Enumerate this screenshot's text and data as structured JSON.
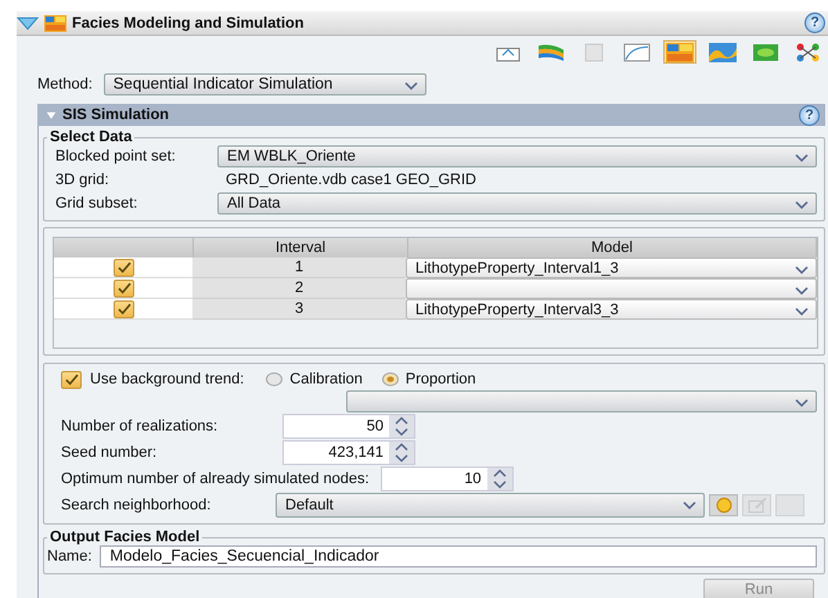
{
  "window": {
    "title": "Facies Modeling and Simulation",
    "expanded": true,
    "help": "?"
  },
  "toolbar": [
    {
      "kind": "tray",
      "selected": false
    },
    {
      "kind": "layers",
      "selected": false
    },
    {
      "kind": "blank",
      "selected": false
    },
    {
      "kind": "curve",
      "selected": false
    },
    {
      "kind": "facies",
      "selected": true
    },
    {
      "kind": "map",
      "selected": false
    },
    {
      "kind": "leaf",
      "selected": false
    },
    {
      "kind": "network",
      "selected": false
    }
  ],
  "method": {
    "label": "Method:",
    "value": "Sequential Indicator Simulation"
  },
  "section": {
    "title": "SIS Simulation",
    "expanded": true,
    "help": "?"
  },
  "select_data": {
    "title": "Select Data",
    "blocked_point_set": {
      "label": "Blocked point set:",
      "value": "EM WBLK_Oriente"
    },
    "grid": {
      "label": "3D grid:",
      "value": "GRD_Oriente.vdb case1 GEO_GRID"
    },
    "grid_subset": {
      "label": "Grid subset:",
      "value": "All Data"
    }
  },
  "table": {
    "columns": [
      "Interval",
      "Model"
    ],
    "rows": [
      {
        "checked": true,
        "interval": "1",
        "model": "LithotypeProperty_Interval1_3"
      },
      {
        "checked": true,
        "interval": "2",
        "model": ""
      },
      {
        "checked": true,
        "interval": "3",
        "model": "LithotypeProperty_Interval3_3"
      }
    ]
  },
  "trend": {
    "label": "Use background trend:",
    "checked": true,
    "options": [
      {
        "label": "Calibration",
        "selected": false
      },
      {
        "label": "Proportion",
        "selected": true
      }
    ]
  },
  "spinners": [
    {
      "label": "Number of realizations:",
      "value": "50"
    },
    {
      "label": "Seed number:",
      "value": "423,141"
    },
    {
      "label": "Optimum number of already simulated nodes:",
      "value": "10"
    }
  ],
  "search_neighborhood": {
    "label": "Search neighborhood:",
    "value": "Default",
    "tools": [
      {
        "kind": "sun",
        "disabled": false
      },
      {
        "kind": "edit",
        "disabled": true
      },
      {
        "kind": "blank",
        "disabled": true
      }
    ]
  },
  "output": {
    "title": "Output Facies Model",
    "label": "Name:",
    "value": "Modelo_Facies_Secuencial_Indicador"
  },
  "run_button": {
    "label": "Run",
    "disabled": true
  }
}
